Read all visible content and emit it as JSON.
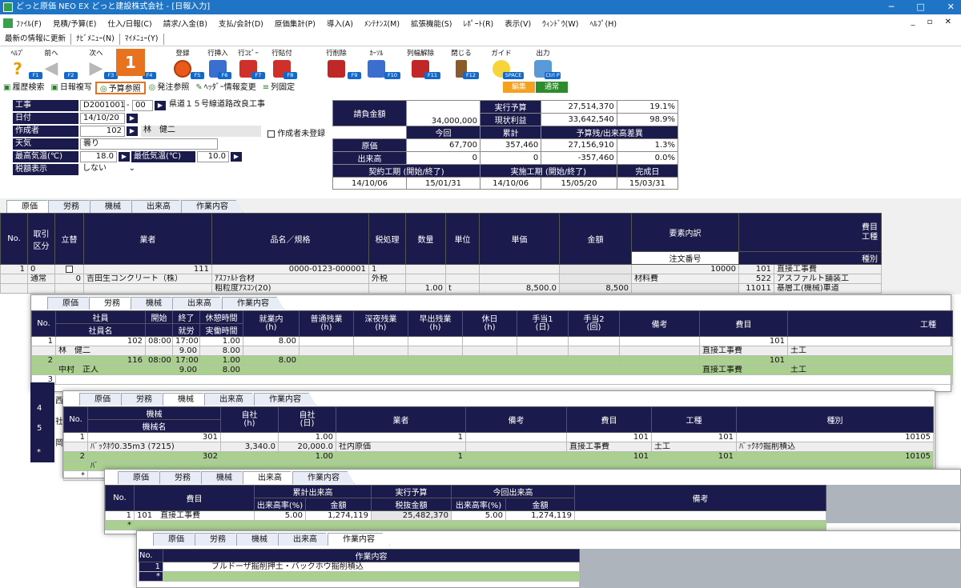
{
  "window": {
    "title": "どっと原価 NEO EX どっと建設株式会社 - [日報入力]",
    "min": "─",
    "max": "□",
    "close": "✕"
  },
  "menu": [
    "ﾌｧｲﾙ(F)",
    "見積/予算(E)",
    "仕入/日報(C)",
    "請求/入金(B)",
    "支払/会計(D)",
    "原価集計(P)",
    "導入(A)",
    "ﾒﾝﾃﾅﾝｽ(M)",
    "拡張機能(S)",
    "ﾚﾎﾟｰﾄ(R)",
    "表示(V)",
    "ｳｨﾝﾄﾞｳ(W)",
    "ﾍﾙﾌﾟ(H)"
  ],
  "mdi_controls": "_ ▫ ✕",
  "subbar": [
    "最新の情報に更新",
    "ﾅﾋﾞﾒﾆｭｰ(N)",
    "ﾏｲﾒﾆｭｰ(Y)"
  ],
  "toolbar": [
    {
      "label": "ﾍﾙﾌﾟ",
      "key": "F1"
    },
    {
      "label": "前へ",
      "key": "F2"
    },
    {
      "label": "次へ",
      "key": "F3"
    },
    {
      "label": "",
      "key": "F4"
    },
    {
      "label": "登録",
      "key": "F5"
    },
    {
      "label": "行挿入",
      "key": "F6"
    },
    {
      "label": "行ｺﾋﾟｰ",
      "key": "F7"
    },
    {
      "label": "行貼付",
      "key": "F8"
    },
    {
      "label": "行削除",
      "key": "F9"
    },
    {
      "label": "ｶｰｿﾙ",
      "key": "F10"
    },
    {
      "label": "列幅解除",
      "key": "F11"
    },
    {
      "label": "閉じる",
      "key": "F12"
    },
    {
      "label": "ガイド",
      "key": "SPACE"
    },
    {
      "label": "出力",
      "key": "Ctrl P"
    }
  ],
  "step_badge": "1",
  "commands": [
    "履歴検索",
    "日報複写",
    "予算参照",
    "発注参照",
    "ﾍｯﾀﾞｰ情報変更",
    "列固定"
  ],
  "modes": {
    "edit": "編集",
    "normal": "通常"
  },
  "header": {
    "koji_label": "工事",
    "koji_code": "D2001001",
    "koji_sep": "-",
    "koji_sub": "00",
    "koji_name": "県道１５号線道路改良工事",
    "date_label": "日付",
    "date": "14/10/20",
    "author_label": "作成者",
    "author_code": "102",
    "author_name": "林　健二",
    "unregistered": "作成者未登録",
    "weather_label": "天気",
    "weather": "曇り",
    "maxtemp_label": "最高気温(℃)",
    "maxtemp": "18.0",
    "mintemp_label": "最低気温(℃)",
    "mintemp": "10.0",
    "tax_label": "税額表示",
    "tax": "しない"
  },
  "summary": {
    "contract_label": "請負金額",
    "contract": "34,000,000",
    "budget_label": "実行予算",
    "budget": "27,514,370",
    "budget_pct": "19.1%",
    "profit_label": "現状利益",
    "profit": "33,642,540",
    "profit_pct": "98.9%",
    "now_label": "今回",
    "total_label": "累計",
    "diff_label": "予算残/出来高差異",
    "cost_label": "原価",
    "cost_now": "67,700",
    "cost_total": "357,460",
    "cost_diff": "27,156,910",
    "cost_pct": "1.3%",
    "prog_label": "出来高",
    "prog_now": "0",
    "prog_total": "0",
    "prog_diff": "-357,460",
    "prog_pct": "0.0%",
    "period1_label": "契約工期 (開始/終了)",
    "period1_s": "14/10/06",
    "period1_e": "15/01/31",
    "period2_label": "実施工期 (開始/終了)",
    "period2_s": "14/10/06",
    "period2_e": "15/05/20",
    "done_label": "完成日",
    "done": "15/03/31"
  },
  "tabs": [
    "原価",
    "労務",
    "機械",
    "出来高",
    "作業内容"
  ],
  "genka": {
    "headers": {
      "no": "No.",
      "torihiki": "取引\n区分",
      "tatekae": "立替",
      "gyosha": "業者",
      "hinmei": "品名／規格",
      "zei": "税処理",
      "suryo": "数量",
      "tani": "単位",
      "tanka": "単価",
      "kingaku": "金額",
      "yoso": "要素内訳",
      "chumon": "注文番号",
      "himoku": "費目",
      "koshu": "工種",
      "shubetsu": "種別"
    },
    "row": {
      "no": "1",
      "torihiki": "0",
      "torihiki_name": "通常",
      "gyosha_code": "111",
      "gyosha_sub": "0",
      "gyosha": "吉田生コンクリート（株）",
      "hin_code": "0000-0123-000001",
      "hin1": "ｱｽﾌｧﾙﾄ合材",
      "hin2": "粗粒度ｱｽｺﾝ(20)",
      "zei_code": "1",
      "zei": "外税",
      "suryo": "1.00",
      "tani": "t",
      "tanka": "8,500.0",
      "kingaku": "8,500",
      "yoso_code": "10000",
      "yoso": "材料費",
      "himoku_code": "101",
      "himoku": "直接工事費",
      "koshu_code": "522",
      "koshu": "アスファルト舗装工",
      "shubetsu_code": "11011",
      "shubetsu": "基層工(機械)車道"
    }
  },
  "romu": {
    "headers": {
      "no": "No.",
      "shain": "社員",
      "shainmei": "社員名",
      "kaishi": "開始",
      "shuryo": "終了",
      "shuro": "就労",
      "kyukei": "休憩時間",
      "jitsudo": "実働時間",
      "shugyo": "就業内\n(h)",
      "futsu": "普通残業\n(h)",
      "shinya": "深夜残業\n(h)",
      "hayade": "早出残業\n(h)",
      "kyujitsu": "休日\n(h)",
      "teate1": "手当1\n(日)",
      "teate2": "手当2\n(回)",
      "biko": "備考",
      "himoku": "費目",
      "koshu": "工種"
    },
    "rows": [
      {
        "no": "1",
        "code": "102",
        "name": "林　健二",
        "start": "08:00",
        "end": "17:00",
        "kyukei": "1.00",
        "shuro": "9.00",
        "jitsudo": "8.00",
        "shugyo": "8.00",
        "himoku_code": "101",
        "himoku": "直接工事費",
        "koshu": "土工"
      },
      {
        "no": "2",
        "code": "116",
        "name": "中村　正人",
        "start": "08:00",
        "end": "17:00",
        "kyukei": "1.00",
        "shuro": "9.00",
        "jitsudo": "8.00",
        "shugyo": "8.00",
        "himoku_code": "101",
        "himoku": "直接工事費",
        "koshu": "土工"
      }
    ],
    "extra_rows": [
      "3",
      "4",
      "5",
      "*"
    ],
    "row_hints": [
      "西",
      "社",
      "岡"
    ]
  },
  "kikai": {
    "headers": {
      "no": "No.",
      "kikai": "機械",
      "kikaimei": "機械名",
      "jisha_h": "自社\n(h)",
      "jisha_d": "自社\n(日)",
      "gyosha": "業者",
      "biko": "備考",
      "himoku": "費目",
      "koshu": "工種",
      "shubetsu": "種別"
    },
    "rows": [
      {
        "no": "1",
        "code": "301",
        "name": "ﾊﾞｯｸﾎｳ0.35m3 (7215)",
        "h": "3,340.0",
        "d_top": "1.00",
        "d": "20,000.0",
        "gyosha_code": "1",
        "gyosha": "社内原価",
        "himoku_code": "101",
        "himoku": "直接工事費",
        "koshu_code": "101",
        "koshu": "土工",
        "shubetsu_code": "10105",
        "shubetsu": "ﾊﾞｯｸﾎｳ掘削積込"
      },
      {
        "no": "2",
        "code": "302",
        "name": "ﾊﾞ",
        "d_top": "1.00",
        "gyosha_code": "1",
        "himoku_code": "101",
        "koshu_code": "101",
        "shubetsu_code": "10105"
      }
    ],
    "extra": "*"
  },
  "dekidaka": {
    "headers": {
      "no": "No.",
      "himoku": "費目",
      "ruikei": "累計出来高",
      "rate": "出来高率(%)",
      "kingaku": "金額",
      "yosan": "実行予算",
      "zeinuki": "税抜金額",
      "konkai": "今回出来高",
      "rate2": "出来高率(%)",
      "kingaku2": "金額",
      "biko": "備考"
    },
    "row": {
      "no": "1",
      "code": "101",
      "name": "直接工事費",
      "rate": "5.00",
      "kingaku": "1,274,119",
      "yosan": "25,482,370",
      "rate2": "5.00",
      "kingaku2": "1,274,119"
    },
    "extra": "*"
  },
  "sagyo": {
    "headers": {
      "no": "No.",
      "naiyo": "作業内容"
    },
    "row": {
      "no": "1",
      "naiyo": "ブルドーザ掘削押土・バックホウ掘削積込"
    },
    "extra": "*"
  }
}
